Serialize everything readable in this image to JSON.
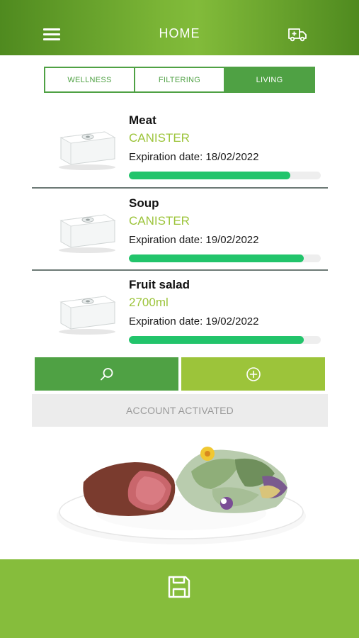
{
  "header": {
    "title": "HOME",
    "menu_icon": "hamburger-menu-icon",
    "action_icon": "ambulance-icon"
  },
  "tabs": [
    {
      "label": "WELLNESS",
      "active": false
    },
    {
      "label": "FILTERING",
      "active": false
    },
    {
      "label": "LIVING",
      "active": true
    }
  ],
  "items": [
    {
      "name": "Meat",
      "type": "CANISTER",
      "expiration": "Expiration date: 18/02/2022",
      "progress": 0.84
    },
    {
      "name": "Soup",
      "type": "CANISTER",
      "expiration": "Expiration date: 19/02/2022",
      "progress": 0.91
    },
    {
      "name": "Fruit salad",
      "type": "2700ml",
      "expiration": "Expiration date: 19/02/2022",
      "progress": 0.91
    }
  ],
  "actions": {
    "search_icon": "search-icon",
    "add_icon": "plus-circle-icon"
  },
  "account_status": "ACCOUNT ACTIVATED",
  "footer": {
    "icon": "save-icon"
  },
  "colors": {
    "brand_green": "#4fa144",
    "lime_green": "#9cc43a",
    "progress_green": "#22c46b",
    "footer_green": "#86bd3c"
  }
}
